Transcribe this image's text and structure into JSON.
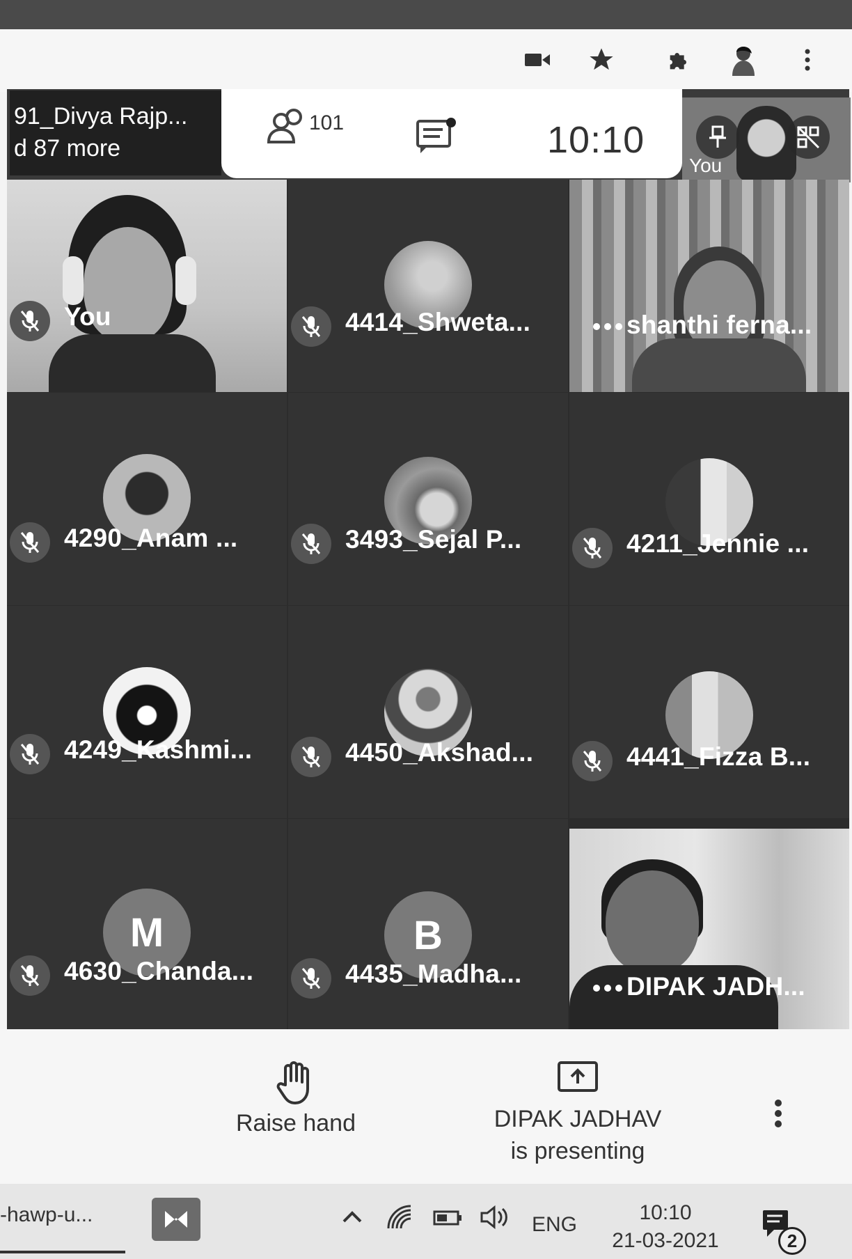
{
  "meet_bar": {
    "toast_line1": "91_Divya Rajp...",
    "toast_line2": "d 87 more",
    "participant_count": "101",
    "clock": "10:10",
    "self_label": "You"
  },
  "tiles": [
    {
      "name": "You",
      "type": "video"
    },
    {
      "name": "4414_Shweta...",
      "type": "avatar"
    },
    {
      "name": "shanthi ferna...",
      "type": "video"
    },
    {
      "name": "4290_Anam ...",
      "type": "avatar"
    },
    {
      "name": "3493_Sejal P...",
      "type": "avatar"
    },
    {
      "name": "4211_Jennie ...",
      "type": "avatar"
    },
    {
      "name": "4249_Kashmi...",
      "type": "avatar"
    },
    {
      "name": "4450_Akshad...",
      "type": "avatar"
    },
    {
      "name": "4441_Fizza B...",
      "type": "avatar"
    },
    {
      "name": "4630_Chanda...",
      "type": "avatar",
      "initial": "M"
    },
    {
      "name": "4435_Madha...",
      "type": "avatar",
      "initial": "B"
    },
    {
      "name": "DIPAK JADH...",
      "type": "video"
    }
  ],
  "controls": {
    "raise_hand_label": "Raise hand",
    "presenter_line1": "DIPAK JADHAV",
    "presenter_line2": "is presenting"
  },
  "taskbar": {
    "app_label": "-hawp-u...",
    "language": "ENG",
    "time": "10:10",
    "date": "21-03-2021",
    "notification_count": "2"
  },
  "icons": {
    "browser": [
      "camera-icon",
      "star-icon",
      "extensions-icon",
      "profile-icon",
      "more-vert-icon"
    ],
    "meet": [
      "people-icon",
      "chat-icon",
      "pin-icon",
      "hide-tile-icon",
      "mic-off-icon",
      "hand-icon",
      "present-icon"
    ],
    "tray": [
      "chevron-up-icon",
      "wifi-icon",
      "battery-icon",
      "volume-icon",
      "notification-icon"
    ]
  }
}
